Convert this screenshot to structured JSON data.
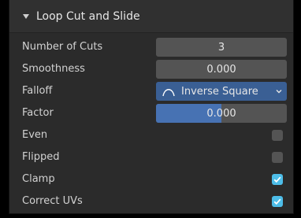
{
  "panel": {
    "title": "Loop Cut and Slide"
  },
  "properties": {
    "number_of_cuts": {
      "label": "Number of Cuts",
      "value": "3"
    },
    "smoothness": {
      "label": "Smoothness",
      "value": "0.000"
    },
    "falloff": {
      "label": "Falloff",
      "value": "Inverse Square",
      "icon": "inverse-square-curve-icon"
    },
    "factor": {
      "label": "Factor",
      "value": "0.000",
      "slider_fill_fraction": 0.5
    },
    "even": {
      "label": "Even",
      "checked": false
    },
    "flipped": {
      "label": "Flipped",
      "checked": false
    },
    "clamp": {
      "label": "Clamp",
      "checked": true
    },
    "correct_uvs": {
      "label": "Correct UVs",
      "checked": true
    }
  },
  "colors": {
    "panel_bg": "#2b2b2b",
    "field_bg": "#545454",
    "dropdown_bg": "#3a5f94",
    "slider_fill": "#4772b3",
    "checkbox_checked": "#4dbde8",
    "text": "#d2d2d2"
  }
}
